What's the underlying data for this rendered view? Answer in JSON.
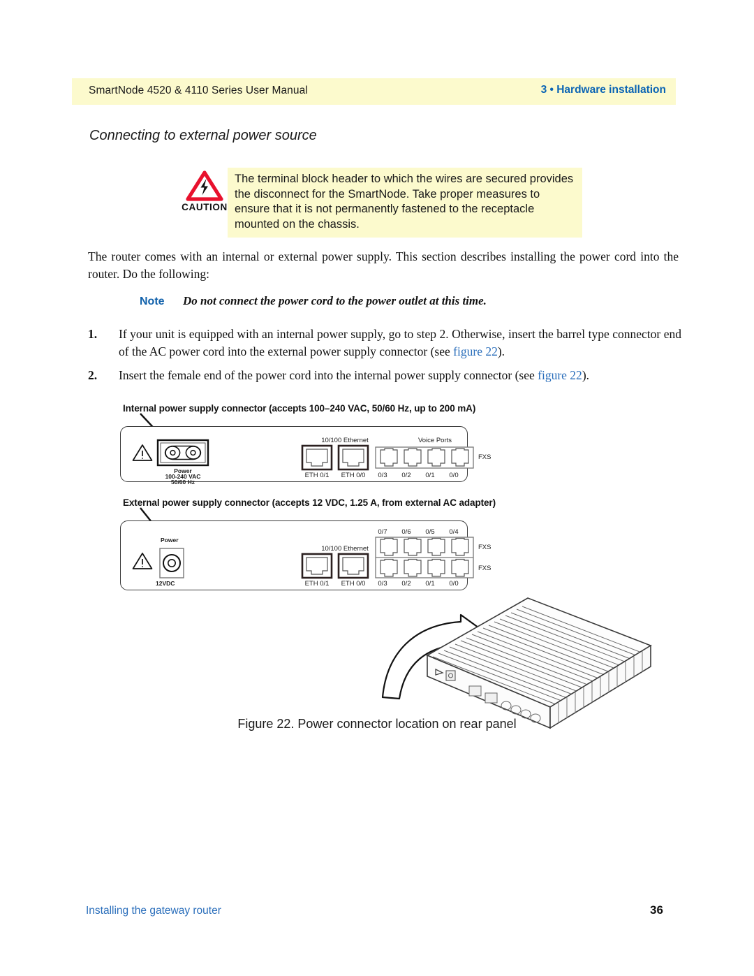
{
  "header": {
    "left_title": "SmartNode 4520 & 4110 Series User Manual",
    "right_title": "3 • Hardware installation",
    "band_color": "#fcfacd",
    "right_color": "#0a64b4"
  },
  "section": {
    "title": "Connecting to external power source"
  },
  "caution": {
    "label": "CAUTION",
    "icon": "warning-triangle-lightning-icon",
    "triangle_color": "#e8112d",
    "background": "#fcfacd",
    "text": "The terminal block header to which the wires are secured provides the disconnect for the SmartNode. Take proper measures to ensure that it is not permanently fastened to the receptacle mounted on the chassis."
  },
  "body": {
    "paragraph": "The router comes with an internal or external power supply. This section describes installing the power cord into the router. Do the following:"
  },
  "note": {
    "label": "Note",
    "label_color": "#1161ab",
    "text": "Do not connect the power cord to the power outlet at this time."
  },
  "steps": [
    {
      "number": "1.",
      "text_before": "If your unit is equipped with an internal power supply, go to step 2. Otherwise, insert the barrel type connector end of the AC power cord into the external power supply connector (see ",
      "link": "figure 22",
      "text_after": ")."
    },
    {
      "number": "2.",
      "text_before": "Insert the female end of the power cord into the internal power supply connector (see ",
      "link": "figure 22",
      "text_after": ")."
    }
  ],
  "figure": {
    "caption": "Figure 22. Power connector location on rear panel",
    "callout_internal": "Internal power supply connector (accepts 100–240 VAC, 50/60 Hz, up to 200 mA)",
    "callout_external": "External power supply connector (accepts 12 VDC, 1.25 A, from external AC adapter)",
    "panel_internal": {
      "power_label": "Power",
      "power_spec_line1": "100-240 VAC",
      "power_spec_line2": "50/60 Hz",
      "ethernet_group": "10/100 Ethernet",
      "voice_group": "Voice Ports",
      "fxs_label": "FXS",
      "eth_ports": [
        "ETH 0/1",
        "ETH 0/0"
      ],
      "voice_ports": [
        "0/3",
        "0/2",
        "0/1",
        "0/0"
      ]
    },
    "panel_external": {
      "power_label": "Power",
      "power_spec": "12VDC",
      "ethernet_group": "10/100 Ethernet",
      "fxs_label_top": "FXS",
      "fxs_label_bottom": "FXS",
      "eth_ports": [
        "ETH 0/1",
        "ETH 0/0"
      ],
      "voice_ports_top": [
        "0/7",
        "0/6",
        "0/5",
        "0/4"
      ],
      "voice_ports_bottom": [
        "0/3",
        "0/2",
        "0/1",
        "0/0"
      ]
    }
  },
  "footer": {
    "left": "Installing the gateway router",
    "page_number": "36",
    "left_color": "#2a6ebb"
  }
}
